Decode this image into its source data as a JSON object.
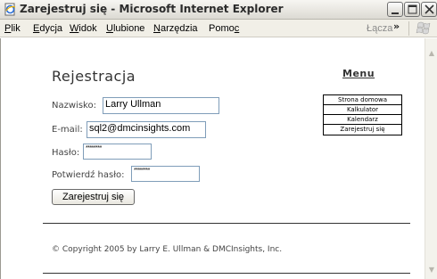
{
  "window": {
    "title": "Zarejestruj się - Microsoft Internet Explorer",
    "app_icon": "ie-document-icon"
  },
  "menubar": {
    "items": [
      {
        "label": "Plik",
        "accel": "P"
      },
      {
        "label": "Edycja",
        "accel": "E"
      },
      {
        "label": "Widok",
        "accel": "W"
      },
      {
        "label": "Ulubione",
        "accel": "U"
      },
      {
        "label": "Narzędzia",
        "accel": "N"
      },
      {
        "label": "Pomoc",
        "accel": "c"
      }
    ],
    "links_label": "Łącza",
    "links_chevron": "»"
  },
  "page": {
    "title": "Rejestracja",
    "menu_heading": "Menu",
    "nav_links": [
      "Strona domowa",
      "Kalkulator",
      "Kalendarz",
      "Zarejestruj się"
    ],
    "form": {
      "name_label": "Nazwisko:",
      "name_value": "Larry Ullman",
      "email_label": "E-mail:",
      "email_value": "sql2@dmcinsights.com",
      "password_label": "Hasło:",
      "password_value": "********",
      "confirm_label": "Potwierdź hasło:",
      "confirm_value": "********",
      "submit_label": "Zarejestruj się"
    },
    "footer": "© Copyright 2005 by Larry E. Ullman & DMCInsights, Inc."
  },
  "colors": {
    "titlebar": "#ebe9e1",
    "menubar": "#f1efe7",
    "input_border": "#7f9db9"
  }
}
